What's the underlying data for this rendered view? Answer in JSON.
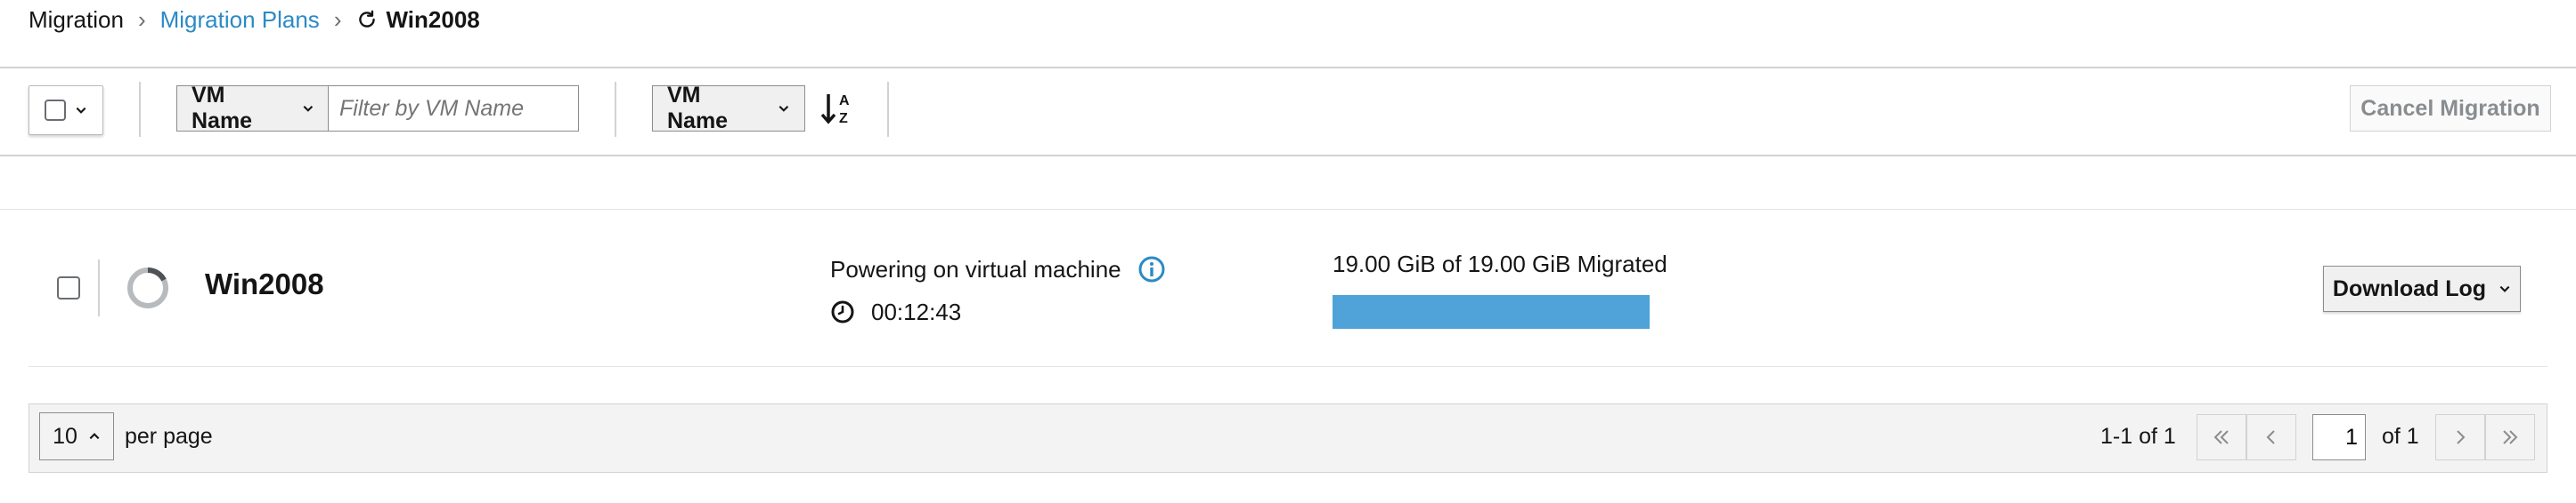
{
  "breadcrumb": {
    "root": "Migration",
    "separator": "›",
    "link": "Migration Plans",
    "current": "Win2008"
  },
  "toolbar": {
    "filter_attribute": "VM Name",
    "filter_placeholder": "Filter by VM Name",
    "sort_attribute": "VM Name",
    "sort_icon": "sort-alpha-down-icon",
    "cancel_label": "Cancel Migration"
  },
  "rows": [
    {
      "name": "Win2008",
      "status": "Powering on virtual machine",
      "elapsed": "00:12:43",
      "progress_text": "19.00 GiB of 19.00 GiB Migrated",
      "progress_percent": 100,
      "action_label": "Download Log"
    }
  ],
  "pagination": {
    "per_page": "10",
    "per_page_label": "per page",
    "range": "1-1 of 1",
    "page": "1",
    "of_total": "of 1"
  },
  "colors": {
    "link": "#2b8ac6",
    "progress": "#4fa3d9",
    "info_icon": "#2b8ac6"
  }
}
